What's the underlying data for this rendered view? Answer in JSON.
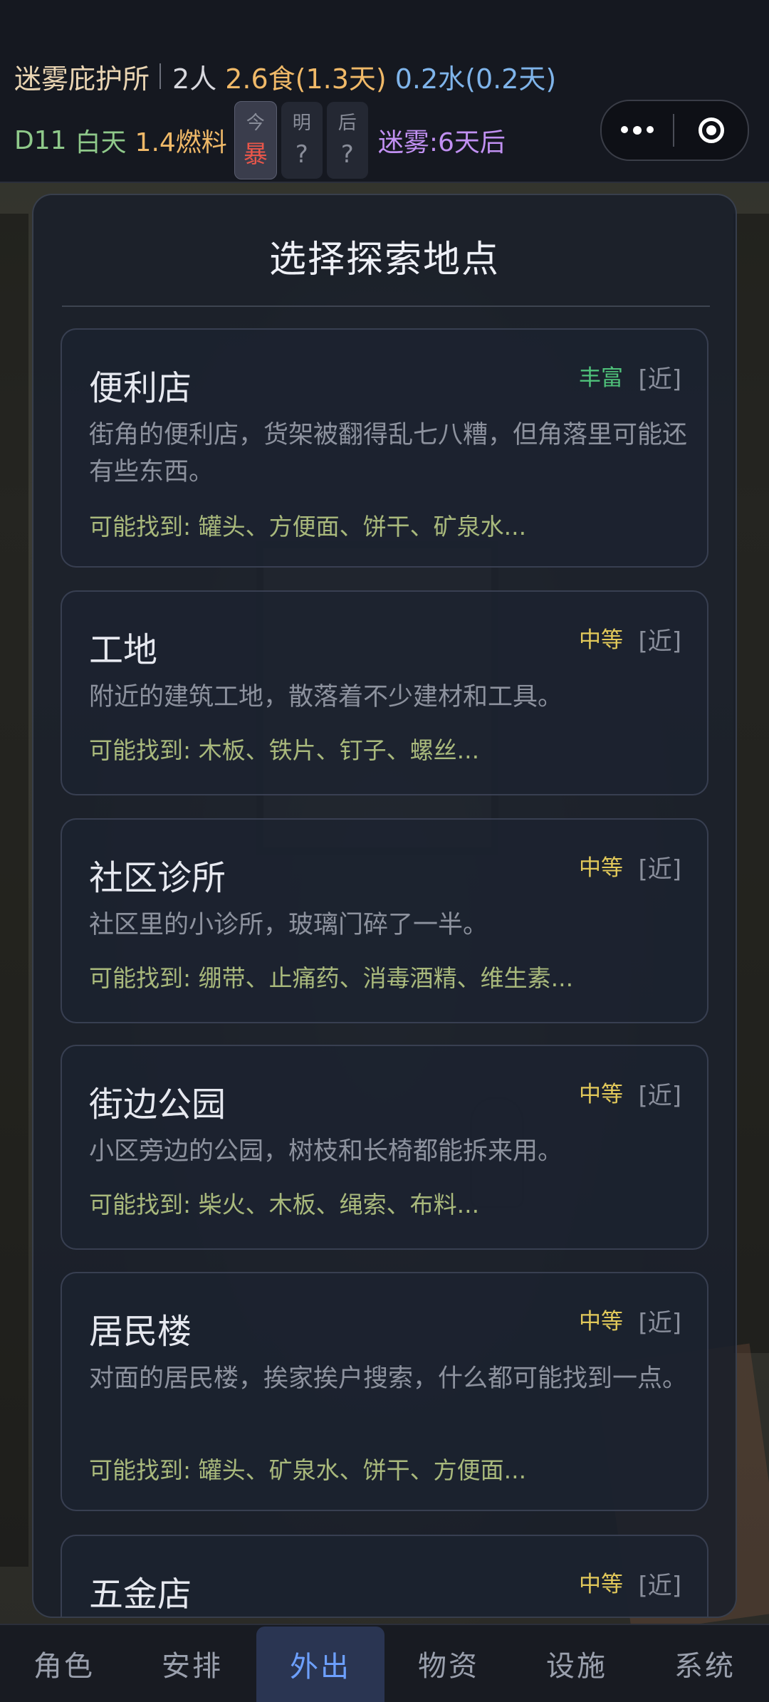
{
  "header": {
    "shelter_name": "迷雾庇护所",
    "people": "2人",
    "food": "2.6食(1.3天)",
    "water": "0.2水(0.2天)",
    "day": "D11",
    "daytime": "白天",
    "fuel": "1.4燃料",
    "weather": [
      {
        "label": "今",
        "value": "暴"
      },
      {
        "label": "明",
        "value": "?"
      },
      {
        "label": "后",
        "value": "?"
      }
    ],
    "fog": "迷雾:6天后"
  },
  "panel": {
    "title": "选择探索地点",
    "locations": [
      {
        "name": "便利店",
        "level": "丰富",
        "distance": "[近]",
        "desc": "街角的便利店，货架被翻得乱七八糟，但角落里可能还有些东西。",
        "finds": "可能找到: 罐头、方便面、饼干、矿泉水..."
      },
      {
        "name": "工地",
        "level": "中等",
        "distance": "[近]",
        "desc": "附近的建筑工地，散落着不少建材和工具。",
        "finds": "可能找到: 木板、铁片、钉子、螺丝..."
      },
      {
        "name": "社区诊所",
        "level": "中等",
        "distance": "[近]",
        "desc": "社区里的小诊所，玻璃门碎了一半。",
        "finds": "可能找到: 绷带、止痛药、消毒酒精、维生素..."
      },
      {
        "name": "街边公园",
        "level": "中等",
        "distance": "[近]",
        "desc": "小区旁边的公园，树枝和长椅都能拆来用。",
        "finds": "可能找到: 柴火、木板、绳索、布料..."
      },
      {
        "name": "居民楼",
        "level": "中等",
        "distance": "[近]",
        "desc": "对面的居民楼，挨家挨户搜索，什么都可能找到一点。",
        "finds": "可能找到: 罐头、矿泉水、饼干、方便面..."
      },
      {
        "name": "五金店",
        "level": "中等",
        "distance": "[近]",
        "desc": "",
        "finds": ""
      }
    ]
  },
  "tabs": [
    "角色",
    "安排",
    "外出",
    "物资",
    "设施",
    "系统"
  ],
  "active_tab": "外出"
}
